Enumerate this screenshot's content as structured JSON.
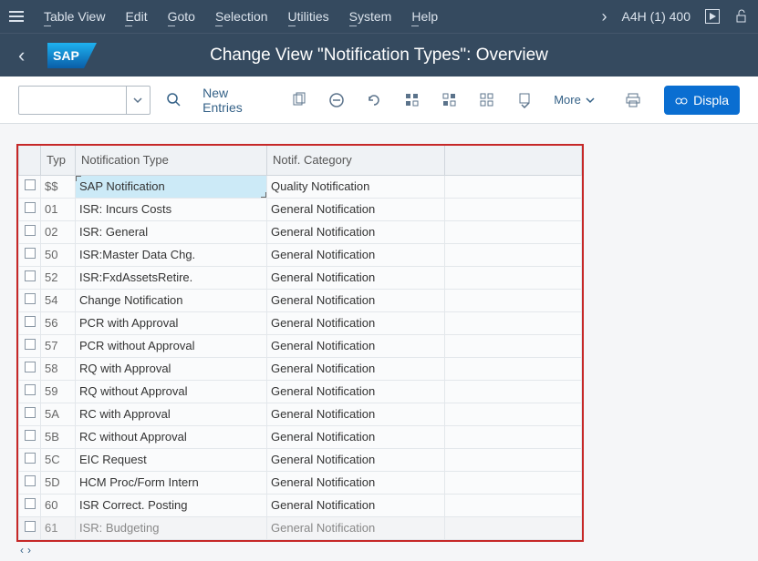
{
  "menubar": {
    "items": [
      "Table View",
      "Edit",
      "Goto",
      "Selection",
      "Utilities",
      "System",
      "Help"
    ],
    "session": "A4H (1) 400"
  },
  "titlebar": {
    "title": "Change View \"Notification Types\": Overview"
  },
  "toolbar": {
    "new_entries": "New Entries",
    "more": "More",
    "display": "Displa"
  },
  "table": {
    "headers": {
      "typ": "Typ",
      "name": "Notification Type",
      "cat": "Notif. Category"
    },
    "rows": [
      {
        "typ": "$$",
        "name": "SAP Notification",
        "cat": "Quality Notification",
        "selected": true
      },
      {
        "typ": "01",
        "name": "ISR: Incurs Costs",
        "cat": "General Notification"
      },
      {
        "typ": "02",
        "name": "ISR: General",
        "cat": "General Notification"
      },
      {
        "typ": "50",
        "name": "ISR:Master Data Chg.",
        "cat": "General Notification"
      },
      {
        "typ": "52",
        "name": "ISR:FxdAssetsRetire.",
        "cat": "General Notification"
      },
      {
        "typ": "54",
        "name": "Change Notification",
        "cat": "General Notification"
      },
      {
        "typ": "56",
        "name": "PCR with Approval",
        "cat": "General Notification"
      },
      {
        "typ": "57",
        "name": "PCR without Approval",
        "cat": "General Notification"
      },
      {
        "typ": "58",
        "name": "RQ with Approval",
        "cat": "General Notification"
      },
      {
        "typ": "59",
        "name": "RQ without Approval",
        "cat": "General Notification"
      },
      {
        "typ": "5A",
        "name": "RC with Approval",
        "cat": "General Notification"
      },
      {
        "typ": "5B",
        "name": "RC without Approval",
        "cat": "General Notification"
      },
      {
        "typ": "5C",
        "name": "EIC Request",
        "cat": "General Notification"
      },
      {
        "typ": "5D",
        "name": "HCM Proc/Form Intern",
        "cat": "General Notification"
      },
      {
        "typ": "60",
        "name": "ISR Correct. Posting",
        "cat": "General Notification"
      },
      {
        "typ": "61",
        "name": "ISR: Budgeting",
        "cat": "General Notification",
        "outside": true
      }
    ]
  }
}
